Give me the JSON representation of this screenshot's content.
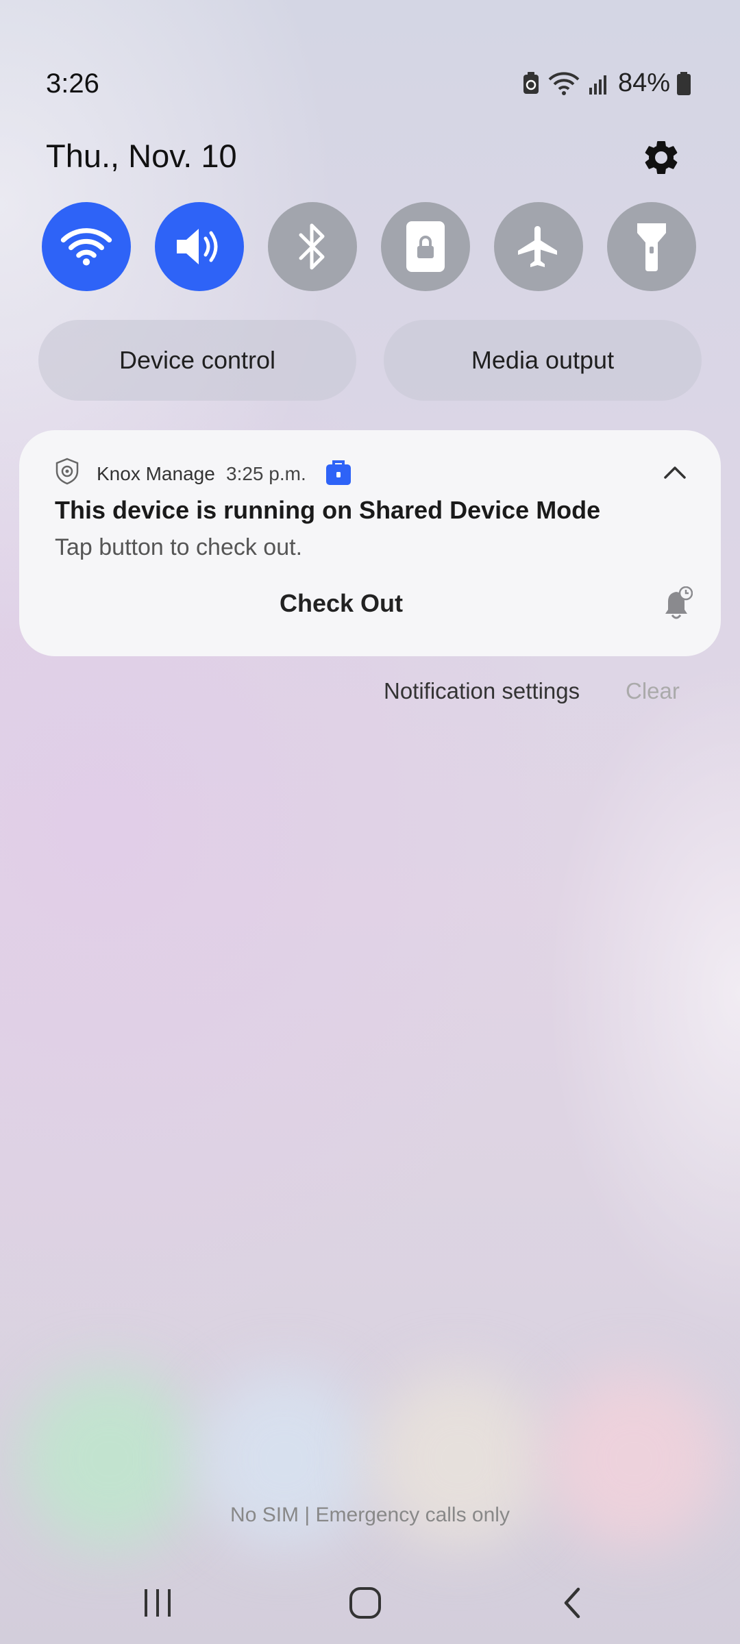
{
  "status_bar": {
    "time": "3:26",
    "battery": "84%"
  },
  "header": {
    "date": "Thu., Nov. 10"
  },
  "quick_tiles": [
    {
      "icon": "wifi-icon",
      "state": "on"
    },
    {
      "icon": "sound-icon",
      "state": "on"
    },
    {
      "icon": "bluetooth-icon",
      "state": "off"
    },
    {
      "icon": "rotation-lock-icon",
      "state": "off"
    },
    {
      "icon": "airplane-icon",
      "state": "off"
    },
    {
      "icon": "flashlight-icon",
      "state": "off"
    }
  ],
  "buttons": {
    "device_control": "Device control",
    "media_output": "Media output"
  },
  "notification": {
    "app_name": "Knox Manage",
    "time": "3:25 p.m.",
    "title": "This device is running on Shared Device Mode",
    "body": "Tap button to check out.",
    "action": "Check Out"
  },
  "footer": {
    "settings": "Notification settings",
    "clear": "Clear"
  },
  "carrier_text": "No SIM | Emergency calls only",
  "colors": {
    "accent": "#2e63f7",
    "tile_off": "#a2a5ad"
  }
}
